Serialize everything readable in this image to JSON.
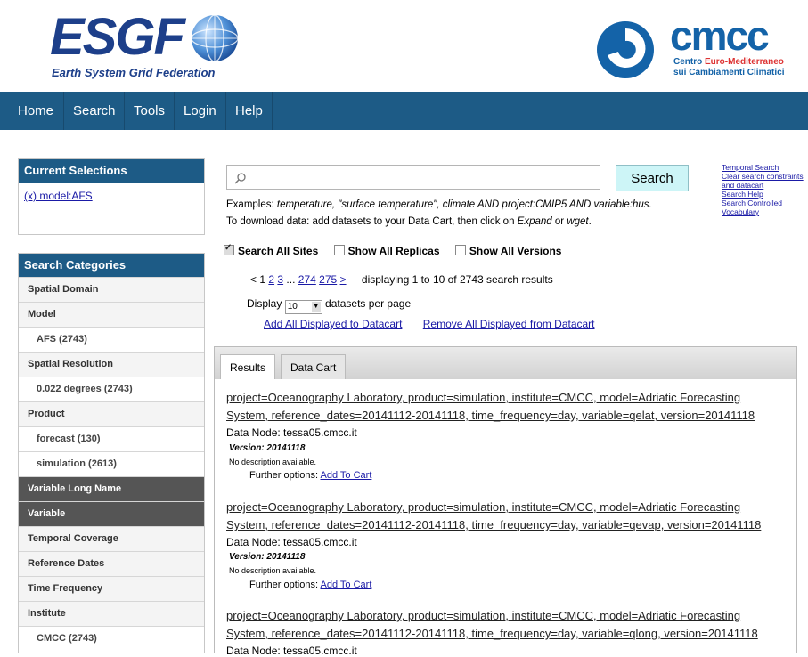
{
  "header": {
    "esgf_word": "ESGF",
    "esgf_subtitle": "Earth System Grid Federation",
    "cmcc_word": "cmcc",
    "cmcc_line1_a": "Centro ",
    "cmcc_line1_b": "Euro-Mediterraneo",
    "cmcc_line2": "sui Cambiamenti Climatici"
  },
  "nav": [
    "Home",
    "Search",
    "Tools",
    "Login",
    "Help"
  ],
  "sidebar": {
    "current_title": "Current Selections",
    "current_item": "(x) model:AFS",
    "categories_title": "Search Categories",
    "categories": [
      {
        "label": "Spatial Domain",
        "kind": "head"
      },
      {
        "label": "Model",
        "kind": "head"
      },
      {
        "label": "AFS (2743)",
        "kind": "sub"
      },
      {
        "label": "Spatial Resolution",
        "kind": "head"
      },
      {
        "label": "0.022 degrees (2743)",
        "kind": "sub"
      },
      {
        "label": "Product",
        "kind": "head"
      },
      {
        "label": "forecast (130)",
        "kind": "sub"
      },
      {
        "label": "simulation (2613)",
        "kind": "sub"
      },
      {
        "label": "Variable Long Name",
        "kind": "dark"
      },
      {
        "label": "Variable",
        "kind": "dark"
      },
      {
        "label": "Temporal Coverage",
        "kind": "head"
      },
      {
        "label": "Reference Dates",
        "kind": "head"
      },
      {
        "label": "Time Frequency",
        "kind": "head"
      },
      {
        "label": "Institute",
        "kind": "head"
      },
      {
        "label": "CMCC (2743)",
        "kind": "sub"
      }
    ]
  },
  "search": {
    "button": "Search",
    "examples_prefix": "Examples: ",
    "examples_text": "temperature, \"surface temperature\", climate AND project:CMIP5 AND variable:hus.",
    "download_prefix": "To download data: add datasets to your Data Cart, then click on ",
    "download_expand": "Expand",
    "download_or": " or ",
    "download_wget": "wget",
    "download_end": ".",
    "links": [
      "Temporal Search",
      "Clear search constraints",
      "and datacart",
      "Search Help",
      "Search Controlled",
      "Vocabulary"
    ],
    "opt_all_sites": "Search All Sites",
    "opt_replicas": "Show All Replicas",
    "opt_versions": "Show All Versions",
    "pager_prev": "< 1",
    "pager_2": "2",
    "pager_3": "3",
    "pager_dots": "...",
    "pager_274": "274",
    "pager_275": "275",
    "pager_next": ">",
    "displaying": "displaying 1 to 10 of 2743 search results",
    "display_label": "Display",
    "display_value": "10",
    "per_page": "datasets per page",
    "add_all": "Add All Displayed to Datacart",
    "remove_all": "Remove All Displayed from Datacart"
  },
  "tabs": [
    "Results",
    "Data Cart"
  ],
  "results": [
    {
      "line1": "project=Oceanography Laboratory, product=simulation, institute=CMCC, model=Adriatic Forecasting",
      "line2": "System, reference_dates=20141112-20141118, time_frequency=day, variable=qelat, version=20141118",
      "node": "Data Node: tessa05.cmcc.it",
      "version": "Version: 20141118",
      "desc": "No description available.",
      "further": "Further options: ",
      "add": "Add To Cart"
    },
    {
      "line1": "project=Oceanography Laboratory, product=simulation, institute=CMCC, model=Adriatic Forecasting",
      "line2": "System, reference_dates=20141112-20141118, time_frequency=day, variable=qevap, version=20141118",
      "node": "Data Node: tessa05.cmcc.it",
      "version": "Version: 20141118",
      "desc": "No description available.",
      "further": "Further options: ",
      "add": "Add To Cart"
    },
    {
      "line1": "project=Oceanography Laboratory, product=simulation, institute=CMCC, model=Adriatic Forecasting",
      "line2": "System, reference_dates=20141112-20141118, time_frequency=day, variable=qlong, version=20141118",
      "node": "Data Node: tessa05.cmcc.it"
    }
  ]
}
